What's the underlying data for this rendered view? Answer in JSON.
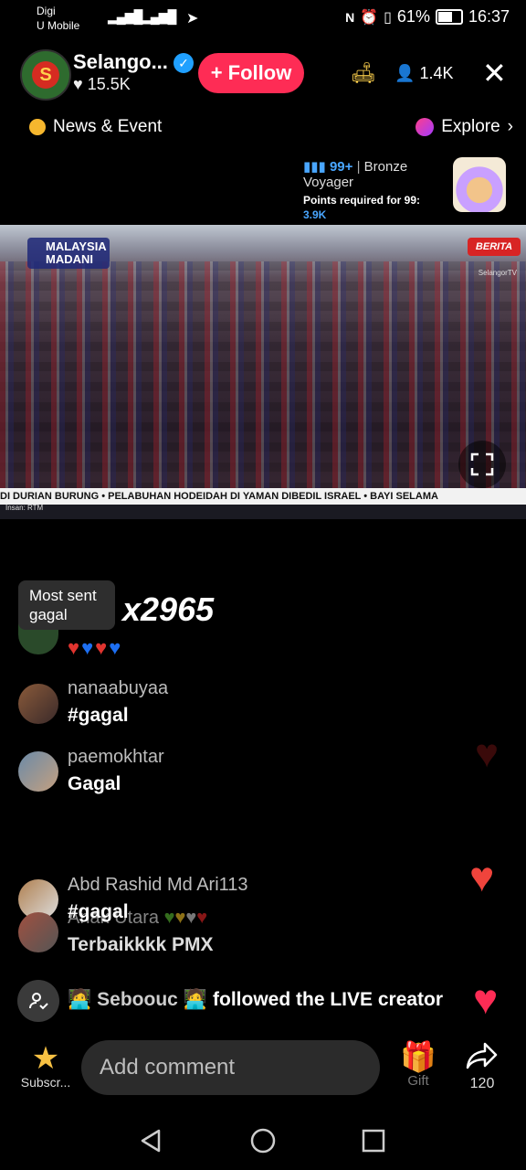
{
  "status_bar": {
    "carrier_1": "Digi",
    "carrier_2": "U Mobile",
    "battery": "61%",
    "time": "16:37"
  },
  "header": {
    "channel_name": "Selango...",
    "likes": "15.5K",
    "follow_label": "+ Follow",
    "viewers": "1.4K",
    "close_icon": "close-icon"
  },
  "topbar": {
    "news_label": "News & Event",
    "explore_label": "Explore"
  },
  "rank": {
    "level": "99+",
    "title": "Bronze Voyager",
    "points_label": "Points required for 99:",
    "points_value": "3.9K"
  },
  "video": {
    "logo_text": "MALAYSIA MADANI",
    "news_badge": "BERITA",
    "watermark": "SelangorTV",
    "ticker": "DI DURIAN BURUNG  •  PELABUHAN HODEIDAH DI YAMAN DIBEDIL ISRAEL  •  BAYI SELAMA",
    "credit": "Insan: RTM"
  },
  "most_sent": {
    "label": "Most sent",
    "word": "gagal",
    "count": "x2965"
  },
  "comments": [
    {
      "username": "nanaabuyaa",
      "text": "#gagal"
    },
    {
      "username": "paemokhtar",
      "text": "Gagal"
    },
    {
      "username": "Abd Rashid Md Ari113",
      "text": "#gagal"
    },
    {
      "username": "Anak Utara",
      "text": "Terbaikkkk PMX"
    }
  ],
  "join_notice": {
    "user": "Seboouc",
    "text": "followed the LIVE creator"
  },
  "bottom_bar": {
    "subscribe_label": "Subscr...",
    "comment_placeholder": "Add comment",
    "gift_label": "Gift",
    "share_count": "120"
  },
  "colors": {
    "accent": "#fe2c55",
    "link_blue": "#49a6ff",
    "verified": "#20a0ff"
  }
}
